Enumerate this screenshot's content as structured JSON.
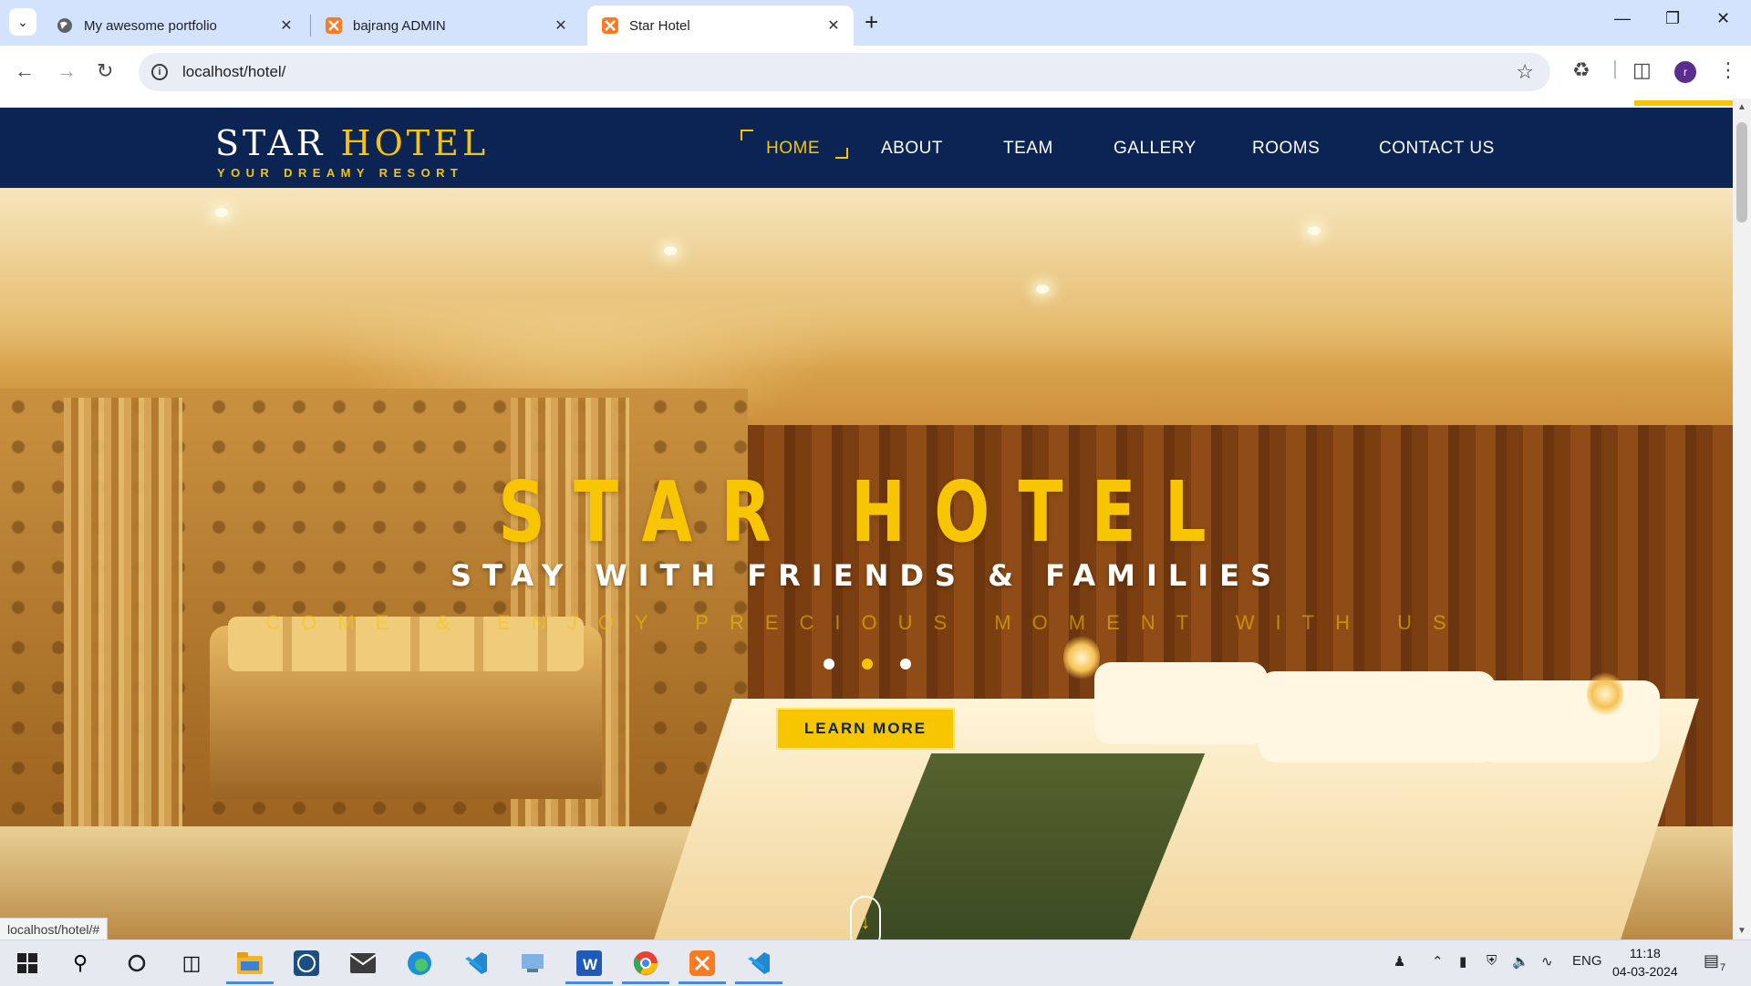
{
  "browser": {
    "tabs": [
      {
        "title": "My awesome portfolio",
        "icon": "globe-icon",
        "active": false
      },
      {
        "title": "bajrang ADMIN",
        "icon": "xampp-icon",
        "active": false
      },
      {
        "title": "Star Hotel",
        "icon": "xampp-icon",
        "active": true
      }
    ],
    "url": "localhost/hotel/",
    "status_link": "localhost/hotel/#",
    "profile_initial": "r"
  },
  "site": {
    "logo": {
      "word1": "STAR",
      "word2": "HOTEL",
      "tagline": "YOUR DREAMY RESORT"
    },
    "menu": [
      {
        "label": "HOME",
        "active": true
      },
      {
        "label": "ABOUT",
        "active": false
      },
      {
        "label": "TEAM",
        "active": false
      },
      {
        "label": "GALLERY",
        "active": false
      },
      {
        "label": "ROOMS",
        "active": false
      },
      {
        "label": "CONTACT US",
        "active": false
      }
    ],
    "hero": {
      "title": "STAR HOTEL",
      "subtitle": "STAY WITH FRIENDS & FAMILIES",
      "tagline": "COME & ENJOY PRECIOUS MOMENT WITH US",
      "button": "LEARN MORE",
      "slides": 3,
      "active_slide": 2
    }
  },
  "taskbar": {
    "language": "ENG",
    "time": "11:18",
    "date": "04-03-2024",
    "notifications": "7"
  },
  "colors": {
    "navy": "#0c2453",
    "gold": "#f7c600",
    "tabbar": "#d3e3fd"
  }
}
